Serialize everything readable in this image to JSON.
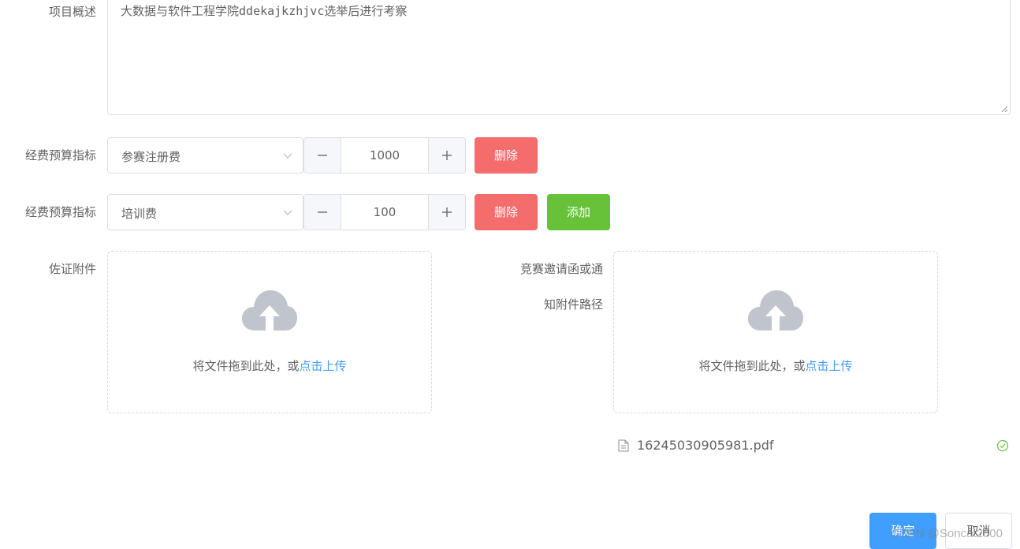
{
  "form": {
    "description": {
      "label": "项目概述",
      "value": "大数据与软件工程学院ddekajkzhjvc选举后进行考察"
    },
    "budget_rows": [
      {
        "label": "经费预算指标",
        "category": "参赛注册费",
        "amount": "1000",
        "delete_label": "删除"
      },
      {
        "label": "经费预算指标",
        "category": "培训费",
        "amount": "100",
        "delete_label": "删除",
        "add_label": "添加"
      }
    ],
    "attachment": {
      "label": "佐证附件",
      "drop_text": "将文件拖到此处，或",
      "upload_link": "点击上传"
    },
    "invitation": {
      "label_line1": "竞赛邀请函或通",
      "label_line2": "知附件路径",
      "drop_text": "将文件拖到此处，或",
      "upload_link": "点击上传",
      "file_name": "16245030905981.pdf"
    }
  },
  "footer": {
    "confirm_label": "确定",
    "cancel_label": "取消"
  },
  "watermark": "CSDN @Soncat2000",
  "colors": {
    "danger": "#f56c6c",
    "success": "#67c23a",
    "primary": "#409eff",
    "upload_icon": "#c0c4cc"
  },
  "icons": {
    "select_arrow": "chevron-down-icon",
    "minus": "minus-icon",
    "plus": "plus-icon",
    "upload": "upload-cloud-icon",
    "file": "document-icon",
    "status": "check-circle-icon"
  }
}
